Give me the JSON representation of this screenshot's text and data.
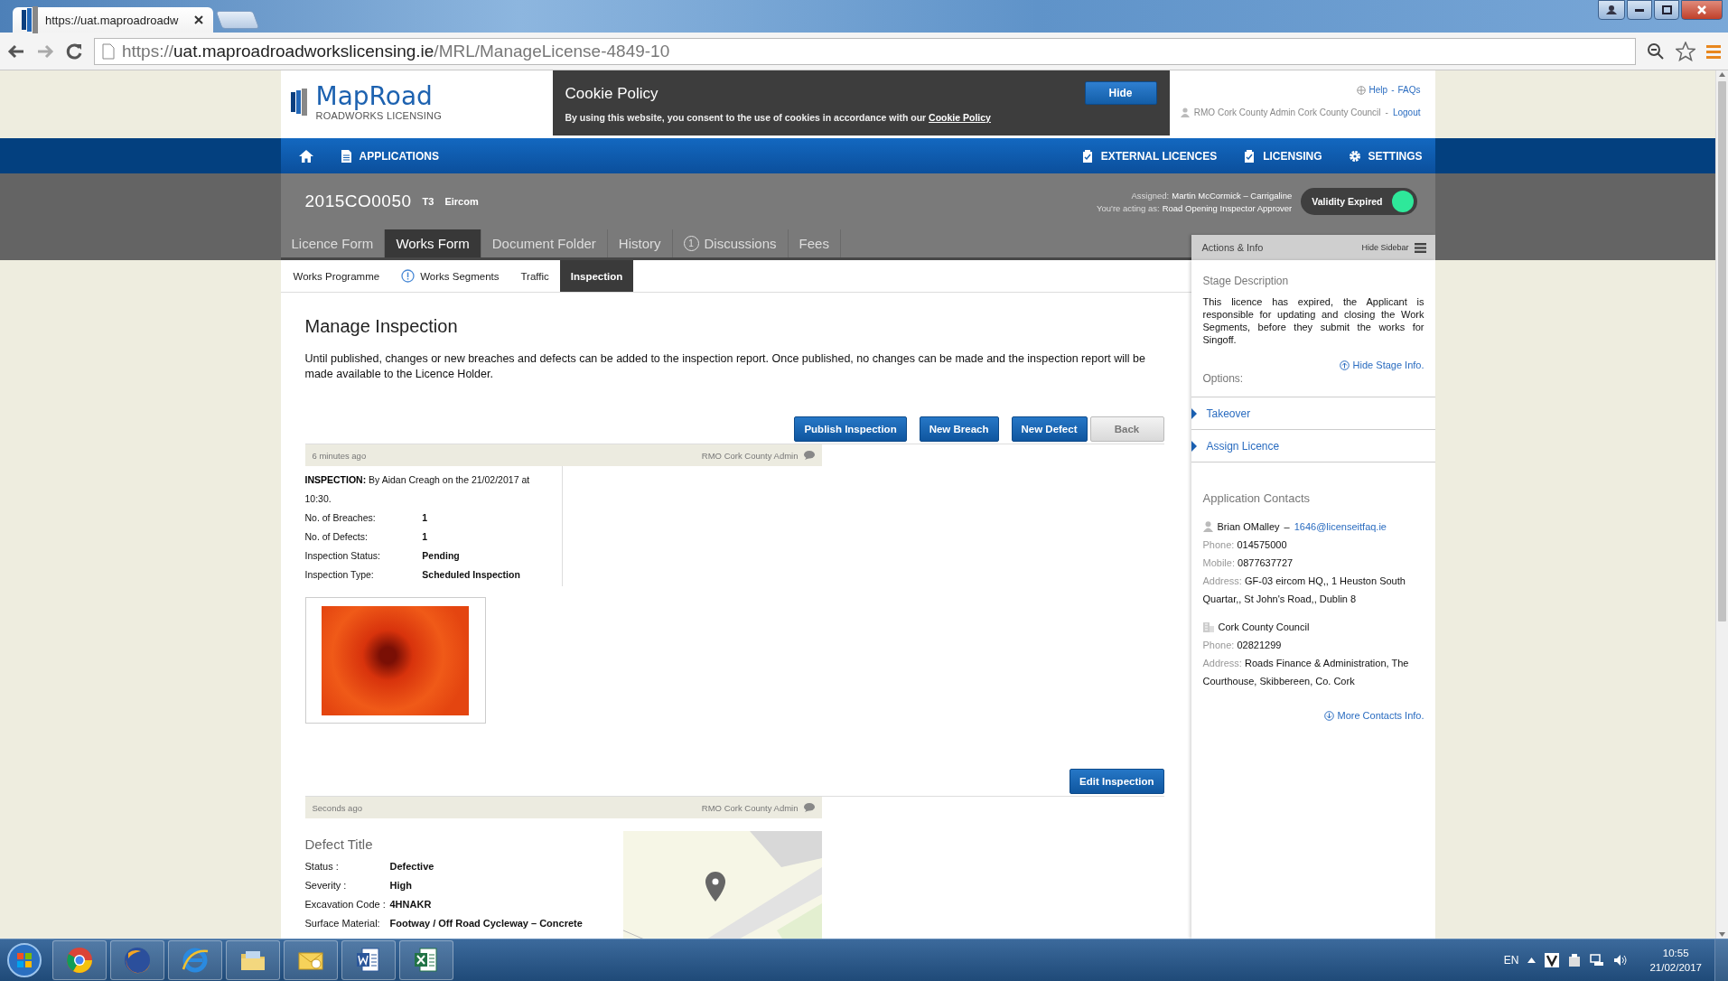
{
  "browser": {
    "tab_title": "https://uat.maproadroadw",
    "url": {
      "scheme": "https://",
      "host": "uat.maproadroadworkslicensing.ie",
      "path": "/MRL/ManageLicense-4849-10"
    }
  },
  "header": {
    "logo_title": "MapRoad",
    "logo_subtitle": "ROADWORKS LICENSING",
    "help_links": [
      "Help",
      "FAQs"
    ],
    "separator": "-",
    "user": "RMO Cork County Admin Cork County Council",
    "logout": "Logout"
  },
  "cookie": {
    "title": "Cookie Policy",
    "text": "By using this website, you consent to the use of cookies in accordance with our",
    "link": "Cookie Policy",
    "button": "Hide"
  },
  "nav": {
    "left": [
      {
        "label": "APPLICATIONS"
      }
    ],
    "right": [
      {
        "label": "EXTERNAL LICENCES"
      },
      {
        "label": "LICENSING"
      },
      {
        "label": "SETTINGS"
      }
    ]
  },
  "licence": {
    "reference": "2015CO0050",
    "type": "T3",
    "company": "Eircom",
    "assigned_label": "Assigned:",
    "assigned": "Martin McCormick – Carrigaline",
    "acting_label": "You're acting as:",
    "acting": "Road Opening Inspector Approver",
    "validity": "Validity Expired"
  },
  "tabs": [
    {
      "label": "Licence Form",
      "selected": false
    },
    {
      "label": "Works Form",
      "selected": true
    },
    {
      "label": "Document Folder",
      "selected": false
    },
    {
      "label": "History",
      "selected": false
    },
    {
      "label": "Discussions",
      "selected": false,
      "badge": "1"
    },
    {
      "label": "Fees",
      "selected": false
    }
  ],
  "sub_tabs": [
    {
      "label": "Works Programme",
      "selected": false,
      "warning": false
    },
    {
      "label": "Works Segments",
      "selected": false,
      "warning": true
    },
    {
      "label": "Traffic",
      "selected": false,
      "warning": false
    },
    {
      "label": "Inspection",
      "selected": true,
      "warning": false
    }
  ],
  "main": {
    "title": "Manage Inspection",
    "intro": "Until published, changes or new breaches and defects can be added to the inspection report. Once published, no changes can be made and the inspection report will be made available to the Licence Holder.",
    "buttons": [
      {
        "label": "Publish Inspection",
        "kind": "primary"
      },
      {
        "label": "New Breach",
        "kind": "primary"
      },
      {
        "label": "New Defect",
        "kind": "primary"
      },
      {
        "label": "Back",
        "kind": "secondary"
      }
    ],
    "entries": [
      {
        "kind": "inspection",
        "time": "6 minutes ago",
        "author": "RMO Cork County Admin",
        "heading_label": "INSPECTION:",
        "heading": "By Aidan Creagh on the 21/02/2017 at 10:30.",
        "fields": [
          {
            "label": "No. of Breaches:",
            "value": "1"
          },
          {
            "label": "No. of Defects:",
            "value": "1"
          },
          {
            "label": "Inspection Status:",
            "value": "Pending"
          },
          {
            "label": "Inspection Type:",
            "value": "Scheduled Inspection"
          }
        ],
        "action": "Edit Inspection"
      },
      {
        "kind": "defect",
        "time": "Seconds ago",
        "author": "RMO Cork County Admin",
        "title": "Defect Title",
        "fields": [
          {
            "label": "Status :",
            "value": "Defective"
          },
          {
            "label": "Severity :",
            "value": "High"
          },
          {
            "label": "Excavation Code :",
            "value": "4HNAKR"
          },
          {
            "label": "Surface Material:",
            "value": "Footway / Off Road Cycleway – Concrete"
          }
        ]
      }
    ]
  },
  "sidebar": {
    "header": "Actions & Info",
    "hide": "Hide Sidebar",
    "stage_title": "Stage Description",
    "stage_text": "This licence has expired, the Applicant is responsible for updating and closing the Work Segments, before they submit the works for Singoff.",
    "hide_stage": "Hide Stage Info.",
    "options_title": "Options:",
    "options": [
      "Takeover",
      "Assign Licence"
    ],
    "contacts_title": "Application Contacts",
    "contacts": [
      {
        "kind": "person",
        "name": "Brian OMalley",
        "separator": "–",
        "email": "1646@licenseitfaq.ie",
        "fields": [
          {
            "label": "Phone:",
            "value": "014575000"
          },
          {
            "label": "Mobile:",
            "value": "0877637727"
          },
          {
            "label": "Address:",
            "value": "GF-03 eircom HQ,, 1 Heuston South Quartar,, St John's Road,, Dublin 8"
          }
        ]
      },
      {
        "kind": "organisation",
        "name": "Cork County Council",
        "fields": [
          {
            "label": "Phone:",
            "value": "02821299"
          },
          {
            "label": "Address:",
            "value": "Roads Finance & Administration, The Courthouse, Skibbereen, Co. Cork"
          }
        ]
      }
    ],
    "more": "More Contacts Info."
  },
  "taskbar": {
    "language": "EN",
    "time": "10:55",
    "date": "21/02/2017"
  }
}
